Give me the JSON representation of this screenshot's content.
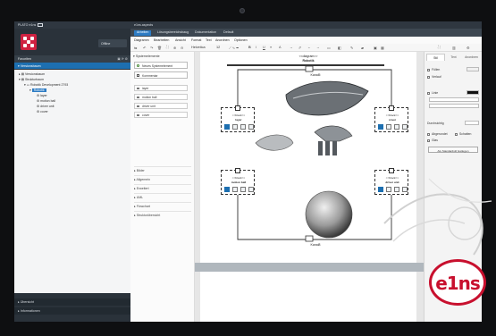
{
  "window": {
    "app_title": "PLATO e1ns",
    "doc_title": "e1ns.aspects"
  },
  "sidebar": {
    "offline_label": "Offline",
    "favorites_label": "Favoriten",
    "versions_label": "Versionsbaum",
    "tree": [
      {
        "label": "Versionsbaum",
        "level": 0
      },
      {
        "label": "Strukturbaum",
        "level": 0
      },
      {
        "label": "Robotik Development 2793",
        "level": 1
      },
      {
        "label": "Robotik",
        "level": 2,
        "selected": true
      },
      {
        "label": "layer",
        "level": 3
      },
      {
        "label": "motion ball",
        "level": 3
      },
      {
        "label": "driver unit",
        "level": 3
      },
      {
        "label": "cover",
        "level": 3
      }
    ],
    "bottom_items": [
      "Übersicht",
      "Informationen"
    ]
  },
  "tabs": [
    "Arbeiten",
    "Lösungsbereichsbaug",
    "Dokumentation",
    "Default"
  ],
  "menu": [
    "Diagramm",
    "Bearbeiten",
    "Ansicht",
    "Format",
    "Text",
    "Anordnen",
    "Optionen"
  ],
  "toolbar": {
    "font_name": "Helvetica",
    "font_size": "12"
  },
  "shapes_panel": {
    "section_title": "Systemelemente",
    "new_button": "Neues Systemelement",
    "comment_button": "Kommentar",
    "items": [
      "layer",
      "motion ball",
      "driver unit",
      "cover"
    ],
    "categories": [
      "Bilder",
      "Allgemein",
      "Erweitert",
      "UML",
      "Flowchart",
      "Strukturübersicht"
    ]
  },
  "diagram": {
    "stereotype_diagram": "<<diagram>>",
    "diagram_name": "Robotik",
    "top_label": "Kanal5",
    "bottom_label": "Kanal8",
    "block_stereotype": "<<block>>",
    "blocks": [
      "layer",
      "cover",
      "motion ball",
      "driver unit"
    ]
  },
  "props": {
    "tabs": [
      "Stil",
      "Text",
      "Anordnen"
    ],
    "rows": [
      "Füllen",
      "Verlauf",
      "Linie",
      "Durchsichtig",
      "Abgerundet",
      "Schatten",
      "Glas"
    ],
    "default_button": "Als Standardstil festlegen"
  },
  "brand": {
    "logo_text": "e1ns",
    "accent": "#c8102e",
    "blue": "#1d6fb0"
  }
}
